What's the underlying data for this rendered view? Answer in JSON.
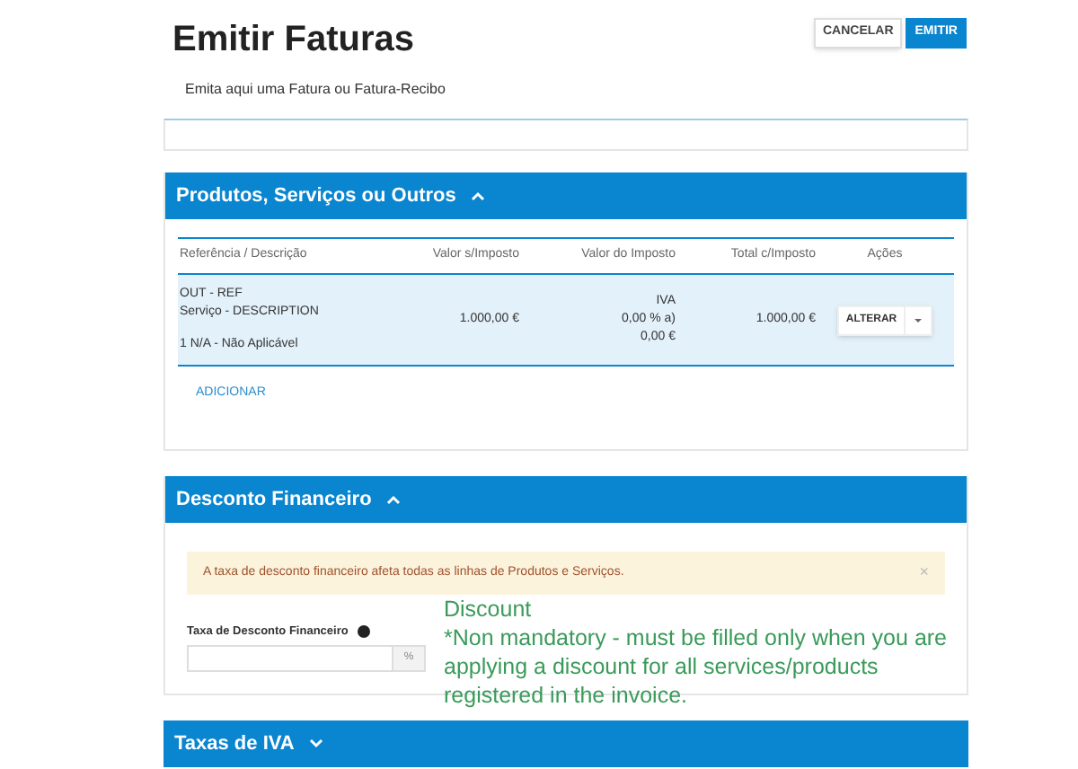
{
  "header": {
    "title": "Emitir Faturas",
    "subtitle": "Emita aqui uma Fatura ou Fatura-Recibo",
    "buttons": [
      {
        "label": "CANCELAR",
        "kind": "secondary"
      },
      {
        "label": "EMITIR",
        "kind": "primary"
      }
    ]
  },
  "products": {
    "title": "Produtos, Serviços ou Outros",
    "expanded": true,
    "columns": [
      "Referência / Descrição",
      "Valor s/Imposto",
      "Valor do Imposto",
      "Total c/Imposto",
      "Ações"
    ],
    "rows": [
      {
        "reference": "OUT - REF",
        "description": "Serviço - DESCRIPTION",
        "quantity": "1 N/A - Não Aplicável",
        "value": "1.000,00 €",
        "tax_lines": [
          "IVA",
          "0,00 % a)",
          "0,00 €"
        ],
        "total": "1.000,00 €",
        "action": "ALTERAR"
      }
    ],
    "add_link": "ADICIONAR"
  },
  "discount": {
    "title": "Desconto Financeiro",
    "expanded": true,
    "alert": "A taxa de desconto financeiro afeta todas as linhas de Produtos e Serviços.",
    "close": "×",
    "field_label": "Taxa de Desconto Financeiro",
    "field_suffix": "%"
  },
  "annotation": {
    "title": "Discount",
    "text": "*Non mandatory - must be filled only when you are applying a discount for all services/products registered in the invoice."
  },
  "vat": {
    "title": "Taxas de IVA",
    "expanded": false
  }
}
